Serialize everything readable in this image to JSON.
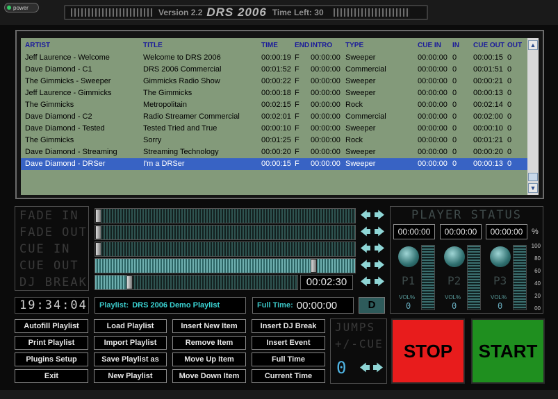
{
  "header": {
    "power_label": "power",
    "version": "Version 2.2",
    "logo": "DRS 2006",
    "time_left": "Time Left: 30"
  },
  "playlist_table": {
    "columns": [
      "ARTIST",
      "TITLE",
      "TIME",
      "END",
      "INTRO",
      "TYPE",
      "CUE IN",
      "IN",
      "CUE OUT",
      "OUT"
    ],
    "rows": [
      {
        "artist": "Jeff Laurence - Welcome",
        "title": "Welcome to DRS 2006",
        "time": "00:00:19",
        "end": "F",
        "intro": "00:00:00",
        "type": "Sweeper",
        "cue_in": "00:00:00",
        "in": "0",
        "cue_out": "00:00:15",
        "out": "0"
      },
      {
        "artist": "Dave Diamond - C1",
        "title": "DRS 2006 Commercial",
        "time": "00:01:52",
        "end": "F",
        "intro": "00:00:00",
        "type": "Commercial",
        "cue_in": "00:00:00",
        "in": "0",
        "cue_out": "00:01:51",
        "out": "0"
      },
      {
        "artist": "The Gimmicks - Sweeper",
        "title": "Gimmicks Radio Show",
        "time": "00:00:22",
        "end": "F",
        "intro": "00:00:00",
        "type": "Sweeper",
        "cue_in": "00:00:00",
        "in": "0",
        "cue_out": "00:00:21",
        "out": "0"
      },
      {
        "artist": "Jeff Laurence - Gimmicks",
        "title": "The Gimmicks",
        "time": "00:00:18",
        "end": "F",
        "intro": "00:00:00",
        "type": "Sweeper",
        "cue_in": "00:00:00",
        "in": "0",
        "cue_out": "00:00:13",
        "out": "0"
      },
      {
        "artist": "The Gimmicks",
        "title": "Metropolitain",
        "time": "00:02:15",
        "end": "F",
        "intro": "00:00:00",
        "type": "Rock",
        "cue_in": "00:00:00",
        "in": "0",
        "cue_out": "00:02:14",
        "out": "0"
      },
      {
        "artist": "Dave Diamond - C2",
        "title": "Radio Streamer Commercial",
        "time": "00:02:01",
        "end": "F",
        "intro": "00:00:00",
        "type": "Commercial",
        "cue_in": "00:00:00",
        "in": "0",
        "cue_out": "00:02:00",
        "out": "0"
      },
      {
        "artist": "Dave Diamond - Tested",
        "title": "Tested Tried and True",
        "time": "00:00:10",
        "end": "F",
        "intro": "00:00:00",
        "type": "Sweeper",
        "cue_in": "00:00:00",
        "in": "0",
        "cue_out": "00:00:10",
        "out": "0"
      },
      {
        "artist": "The Gimmicks",
        "title": "Sorry",
        "time": "00:01:25",
        "end": "F",
        "intro": "00:00:00",
        "type": "Rock",
        "cue_in": "00:00:00",
        "in": "0",
        "cue_out": "00:01:21",
        "out": "0"
      },
      {
        "artist": "Dave Diamond - Streaming",
        "title": "Streaming Technology",
        "time": "00:00:20",
        "end": "F",
        "intro": "00:00:00",
        "type": "Sweeper",
        "cue_in": "00:00:00",
        "in": "0",
        "cue_out": "00:00:20",
        "out": "0"
      },
      {
        "artist": "Dave Diamond - DRSer",
        "title": "I'm a DRSer",
        "time": "00:00:15",
        "end": "F",
        "intro": "00:00:00",
        "type": "Sweeper",
        "cue_in": "00:00:00",
        "in": "0",
        "cue_out": "00:00:13",
        "out": "0",
        "selected": true
      }
    ]
  },
  "markers": {
    "labels": [
      "FADE IN",
      "FADE OUT",
      "CUE IN",
      "CUE OUT",
      "DJ BREAK"
    ],
    "slider_levels": [
      0.0,
      0.0,
      0.0,
      0.85,
      0.16
    ],
    "dj_break_time": "00:02:30"
  },
  "clock": "19:34:04",
  "playlist_info": {
    "playlist_label": "Playlist:",
    "playlist_name": "DRS 2006 Demo Playlist",
    "fulltime_label": "Full Time:",
    "fulltime_value": "00:00:00",
    "d_button": "D"
  },
  "player_status": {
    "title": "PLAYER STATUS",
    "percent_label": "%",
    "players": [
      {
        "label": "P1",
        "time": "00:00:00",
        "vol_label": "VOL%",
        "vol": "0"
      },
      {
        "label": "P2",
        "time": "00:00:00",
        "vol_label": "VOL%",
        "vol": "0"
      },
      {
        "label": "P3",
        "time": "00:00:00",
        "vol_label": "VOL%",
        "vol": "0"
      }
    ],
    "scale": [
      "100",
      "80",
      "60",
      "40",
      "20",
      "00"
    ]
  },
  "buttons": {
    "col1": [
      "Autofill Playlist",
      "Print Playlist",
      "Plugins Setup",
      "Exit"
    ],
    "col2": [
      "Load Playlist",
      "Import Playlist",
      "Save Playlist as",
      "New Playlist"
    ],
    "col3": [
      "Insert New Item",
      "Remove Item",
      "Move Up Item",
      "Move Down Item"
    ],
    "col4": [
      "Insert DJ Break",
      "Insert Event",
      "Full Time",
      "Current Time"
    ]
  },
  "jumps": {
    "title": "JUMPS",
    "subtitle": "+/-CUE",
    "value": "0"
  },
  "transport": {
    "stop": "STOP",
    "start": "START",
    "stop_color": "#e81c1c",
    "start_color": "#1f8f1f"
  }
}
